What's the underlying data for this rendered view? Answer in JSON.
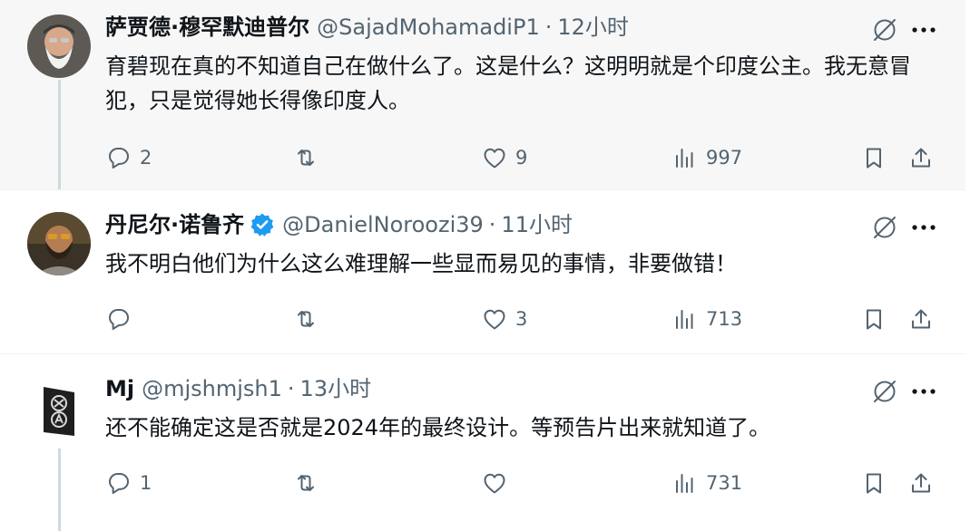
{
  "tweets": [
    {
      "name": "萨贾德·穆罕默迪普尔",
      "handle": "@SajadMohamadiP1",
      "separator": "·",
      "time": "12小时",
      "text": "育碧现在真的不知道自己在做什么了。这是什么？这明明就是个印度公主。我无意冒犯，只是觉得她长得像印度人。",
      "replies": "2",
      "retweets": "",
      "likes": "9",
      "views": "997"
    },
    {
      "name": "丹尼尔·诺鲁齐",
      "handle": "@DanielNoroozi39",
      "separator": "·",
      "time": "11小时",
      "text": "我不明白他们为什么这么难理解一些显而易见的事情，非要做错！",
      "replies": "",
      "retweets": "",
      "likes": "3",
      "views": "713"
    },
    {
      "name": "Mj",
      "handle": "@mjshmjsh1",
      "separator": "·",
      "time": "13小时",
      "text": "还不能确定这是否就是2024年的最终设计。等预告片出来就知道了。",
      "replies": "1",
      "retweets": "",
      "likes": "",
      "views": "731"
    }
  ],
  "colors": {
    "text": "#0f1419",
    "muted": "#536471",
    "verified": "#1d9bf0",
    "thread_line": "#cfd9de"
  },
  "icons": [
    "reply-icon",
    "retweet-icon",
    "like-icon",
    "views-icon",
    "bookmark-icon",
    "share-icon",
    "grok-icon",
    "more-icon",
    "verified-badge-icon"
  ]
}
